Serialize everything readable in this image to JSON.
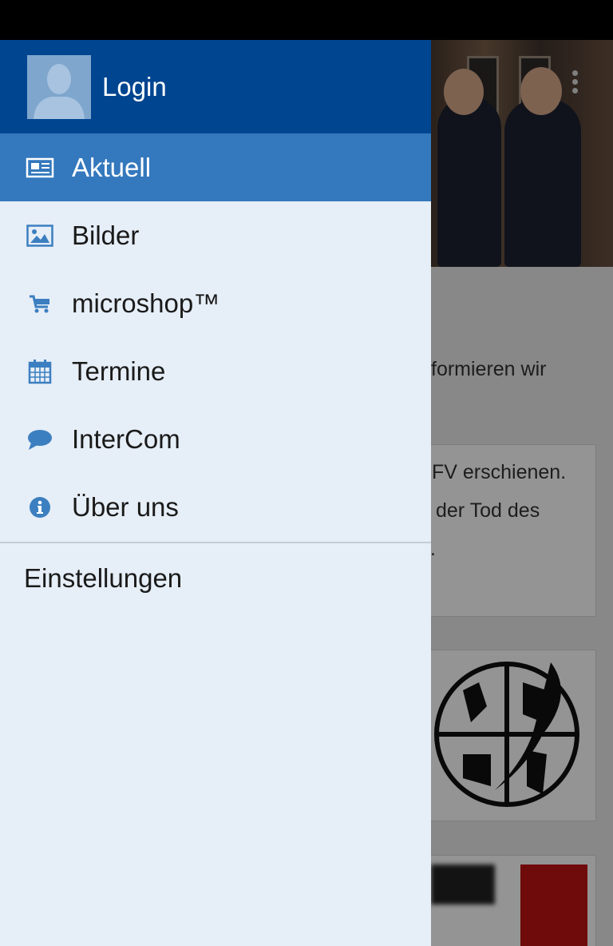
{
  "drawer": {
    "login_label": "Login",
    "items": [
      {
        "label": "Aktuell",
        "icon": "newspaper-icon",
        "active": true
      },
      {
        "label": "Bilder",
        "icon": "image-icon",
        "active": false
      },
      {
        "label": "microshop™",
        "icon": "cart-icon",
        "active": false
      },
      {
        "label": "Termine",
        "icon": "calendar-icon",
        "active": false
      },
      {
        "label": "InterCom",
        "icon": "chat-bubble-icon",
        "active": false
      },
      {
        "label": "Über uns",
        "icon": "info-icon",
        "active": false
      }
    ],
    "settings_label": "Einstellungen"
  },
  "background": {
    "intro_text": "formieren wir",
    "card_lines": [
      "FV erschienen.",
      "der Tod des",
      "."
    ]
  },
  "colors": {
    "header": "#004590",
    "active_item": "#3478bd",
    "drawer_bg": "#e6eef7",
    "icon": "#3c7fc0"
  }
}
